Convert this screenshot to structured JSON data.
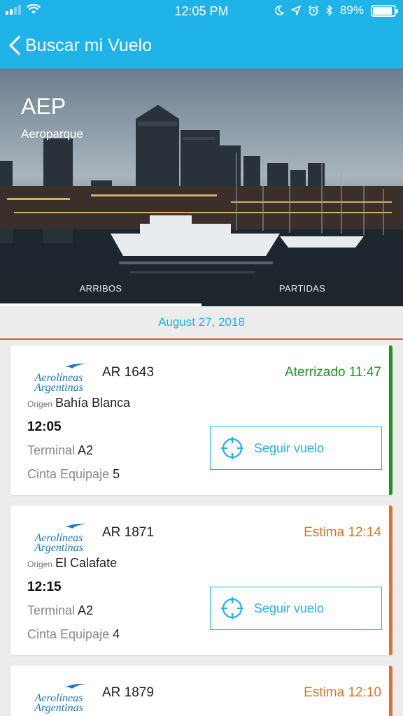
{
  "status_bar": {
    "time": "12:05 PM",
    "battery": "89%",
    "battery_level": 0.89
  },
  "nav": {
    "title": "Buscar mi Vuelo"
  },
  "airport": {
    "code": "AEP",
    "name": "Aeroparque"
  },
  "tabs": [
    {
      "label": "ARRIBOS",
      "active": true
    },
    {
      "label": "PARTIDAS",
      "active": false
    }
  ],
  "date": "August 27, 2018",
  "flights": [
    {
      "airline": "Aerolíneas Argentinas",
      "logo_line1": "Aerolíneas",
      "logo_line2": "Argentinas",
      "number": "AR 1643",
      "status": "Aterrizado 11:47",
      "status_color": "#18981d",
      "origin_label": "Origen",
      "origin": "Bahía Blanca",
      "time": "12:05",
      "terminal_label": "Terminal",
      "terminal": "A2",
      "belt_label": "Cinta Equipaje",
      "belt": "5",
      "follow_label": "Seguir vuelo"
    },
    {
      "airline": "Aerolíneas Argentinas",
      "logo_line1": "Aerolíneas",
      "logo_line2": "Argentinas",
      "number": "AR 1871",
      "status": "Estima 12:14",
      "status_color": "#d9752c",
      "origin_label": "Origen",
      "origin": "El Calafate",
      "time": "12:15",
      "terminal_label": "Terminal",
      "terminal": "A2",
      "belt_label": "Cinta Equipaje",
      "belt": "4",
      "follow_label": "Seguir vuelo"
    },
    {
      "airline": "Aerolíneas Argentinas",
      "logo_line1": "Aerolíneas",
      "logo_line2": "Argentinas",
      "number": "AR 1879",
      "status": "Estima 12:10",
      "status_color": "#d9752c"
    }
  ],
  "colors": {
    "brand": "#1fb3e8",
    "divider": "#e2563f"
  }
}
